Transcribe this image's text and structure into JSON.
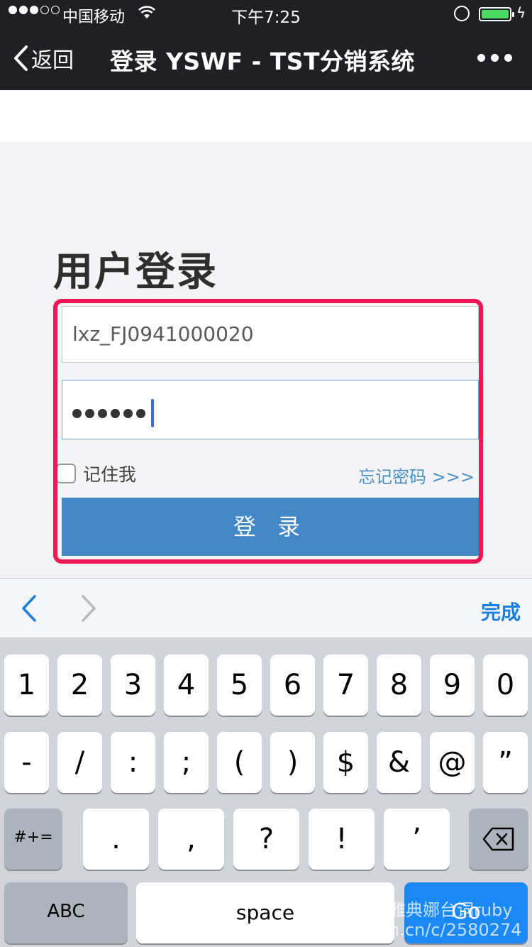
{
  "status_bar": {
    "carrier": "中国移动",
    "time": "下午7:25",
    "signal_bars": 3,
    "signal_total": 5,
    "battery_level": 1.0
  },
  "nav": {
    "back_label": "返回",
    "title": "登录 YSWF - TST分销系统"
  },
  "page": {
    "heading": "用户登录"
  },
  "login_form": {
    "username_value": "lxz_FJ0941000020",
    "password_length": 6,
    "remember_label": "记住我",
    "forgot_label": "忘记密码 >>>",
    "submit_label": "登 录",
    "accent_color": "#4288c8",
    "highlight_color": "#ee1654"
  },
  "keyboard_bar": {
    "done_label": "完成"
  },
  "keyboard": {
    "row1": [
      "1",
      "2",
      "3",
      "4",
      "5",
      "6",
      "7",
      "8",
      "9",
      "0"
    ],
    "row2": [
      "-",
      "/",
      ":",
      ";",
      "(",
      ")",
      "$",
      "&",
      "@",
      "”"
    ],
    "row3_left": "#+=",
    "row3": [
      ".",
      ",",
      "?",
      "!",
      "’"
    ],
    "abc_label": "ABC",
    "space_label": "space",
    "go_label": "Go"
  },
  "watermark": {
    "line1": "雅典娜台词ruby",
    "line2": "n.cn/c/2580274"
  }
}
